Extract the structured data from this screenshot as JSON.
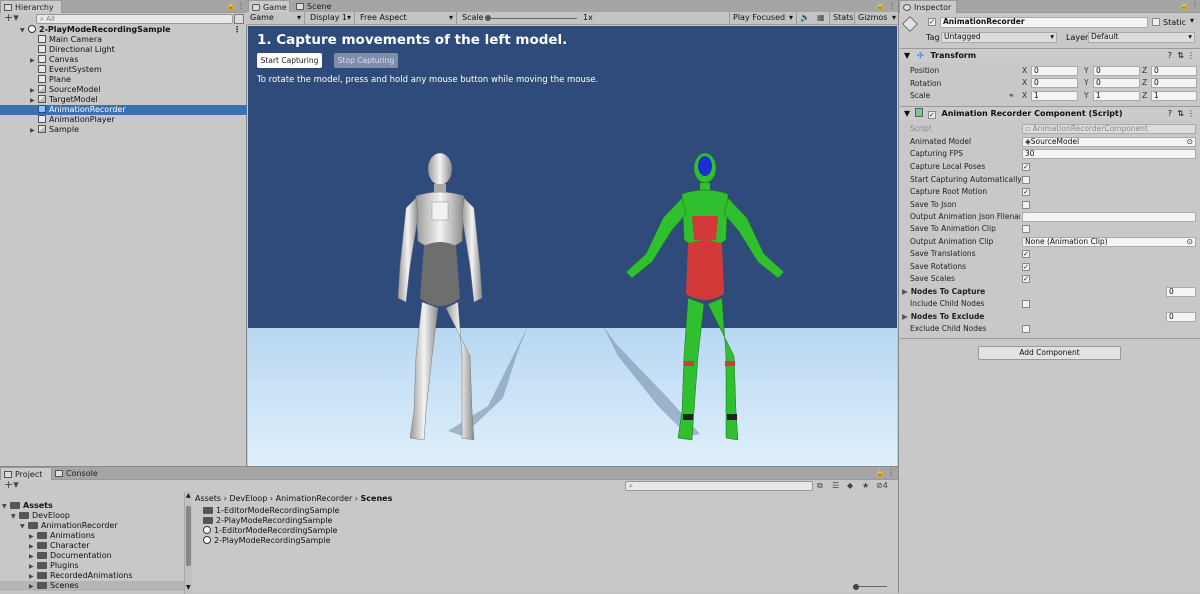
{
  "hierarchy": {
    "tab": "Hierarchy",
    "search_placeholder": "All",
    "scene_name": "2-PlayModeRecordingSample",
    "items": [
      {
        "label": "Main Camera",
        "type": "go",
        "expand": false
      },
      {
        "label": "Directional Light",
        "type": "go",
        "expand": false
      },
      {
        "label": "Canvas",
        "type": "go",
        "expand": true
      },
      {
        "label": "EventSystem",
        "type": "go",
        "expand": false
      },
      {
        "label": "Plane",
        "type": "go",
        "expand": false
      },
      {
        "label": "SourceModel",
        "type": "prefab",
        "expand": true
      },
      {
        "label": "TargetModel",
        "type": "prefab",
        "expand": true
      },
      {
        "label": "AnimationRecorder",
        "type": "go",
        "expand": false,
        "selected": true
      },
      {
        "label": "AnimationPlayer",
        "type": "go",
        "expand": false
      },
      {
        "label": "Sample",
        "type": "prefab",
        "expand": true
      }
    ]
  },
  "center_tabs": {
    "game": "Game",
    "scene": "Scene"
  },
  "game_toolbar": {
    "mode": "Game",
    "display": "Display 1",
    "aspect": "Free Aspect",
    "scale_label": "Scale",
    "scale_value": "1x",
    "play_focused": "Play Focused",
    "stats": "Stats",
    "gizmos": "Gizmos"
  },
  "game_view": {
    "heading": "1. Capture movements of the left model.",
    "start_button": "Start Capturing",
    "stop_button": "Stop Capturing",
    "instruction": "To rotate the model, press and hold any mouse button while moving the mouse.",
    "colors": {
      "sky": "#2f4b7b",
      "floor": "#cfe6f8",
      "green": "#2fbf2f",
      "red": "#d23a3a",
      "visor": "#1b2fd0"
    }
  },
  "inspector": {
    "tab": "Inspector",
    "object_name": "AnimationRecorder",
    "static_label": "Static",
    "tag_label": "Tag",
    "tag_value": "Untagged",
    "layer_label": "Layer",
    "layer_value": "Default",
    "transform": {
      "title": "Transform",
      "position_label": "Position",
      "rotation_label": "Rotation",
      "scale_label": "Scale",
      "position": [
        "0",
        "0",
        "0"
      ],
      "rotation": [
        "0",
        "0",
        "0"
      ],
      "scale": [
        "1",
        "1",
        "1"
      ]
    },
    "component": {
      "title": "Animation Recorder Component (Script)",
      "script_label": "Script",
      "script_value": "AnimationRecorderComponent",
      "animated_model_label": "Animated Model",
      "animated_model_value": "SourceModel",
      "capture_fps_label": "Capturing FPS",
      "capture_fps_value": "30",
      "rows": [
        {
          "label": "Capture Local Poses",
          "checked": true
        },
        {
          "label": "Start Capturing Automatically",
          "checked": false
        },
        {
          "label": "Capture Root Motion",
          "checked": true
        },
        {
          "label": "Save To Json",
          "checked": false
        }
      ],
      "json_filename_label": "Output Animation Json Filename",
      "save_clip_label": "Save To Animation Clip",
      "save_clip_checked": false,
      "output_clip_label": "Output Animation Clip",
      "output_clip_value": "None (Animation Clip)",
      "rows2": [
        {
          "label": "Save Translations",
          "checked": true
        },
        {
          "label": "Save Rotations",
          "checked": true
        },
        {
          "label": "Save Scales",
          "checked": true
        }
      ],
      "nodes_capture_label": "Nodes To Capture",
      "nodes_capture_count": "0",
      "include_child_label": "Include Child Nodes",
      "nodes_exclude_label": "Nodes To Exclude",
      "nodes_exclude_count": "0",
      "exclude_child_label": "Exclude Child Nodes"
    },
    "add_component": "Add Component"
  },
  "project": {
    "tab_project": "Project",
    "tab_console": "Console",
    "hidden_count": "4",
    "tree": [
      {
        "label": "Assets",
        "indent": 0,
        "bold": true,
        "open": true
      },
      {
        "label": "DevEloop",
        "indent": 1,
        "open": true
      },
      {
        "label": "AnimationRecorder",
        "indent": 2,
        "open": true
      },
      {
        "label": "Animations",
        "indent": 3,
        "open": false
      },
      {
        "label": "Character",
        "indent": 3,
        "open": false
      },
      {
        "label": "Documentation",
        "indent": 3,
        "open": false
      },
      {
        "label": "Plugins",
        "indent": 3,
        "open": false
      },
      {
        "label": "RecordedAnimations",
        "indent": 3,
        "open": false
      },
      {
        "label": "Scenes",
        "indent": 3,
        "open": false,
        "selected": true
      }
    ],
    "breadcrumb": [
      "Assets",
      "DevEloop",
      "AnimationRecorder",
      "Scenes"
    ],
    "files": [
      {
        "label": "1-EditorModeRecordingSample",
        "type": "folder"
      },
      {
        "label": "2-PlayModeRecordingSample",
        "type": "folder"
      },
      {
        "label": "1-EditorModeRecordingSample",
        "type": "scene"
      },
      {
        "label": "2-PlayModeRecordingSample",
        "type": "scene"
      }
    ]
  }
}
